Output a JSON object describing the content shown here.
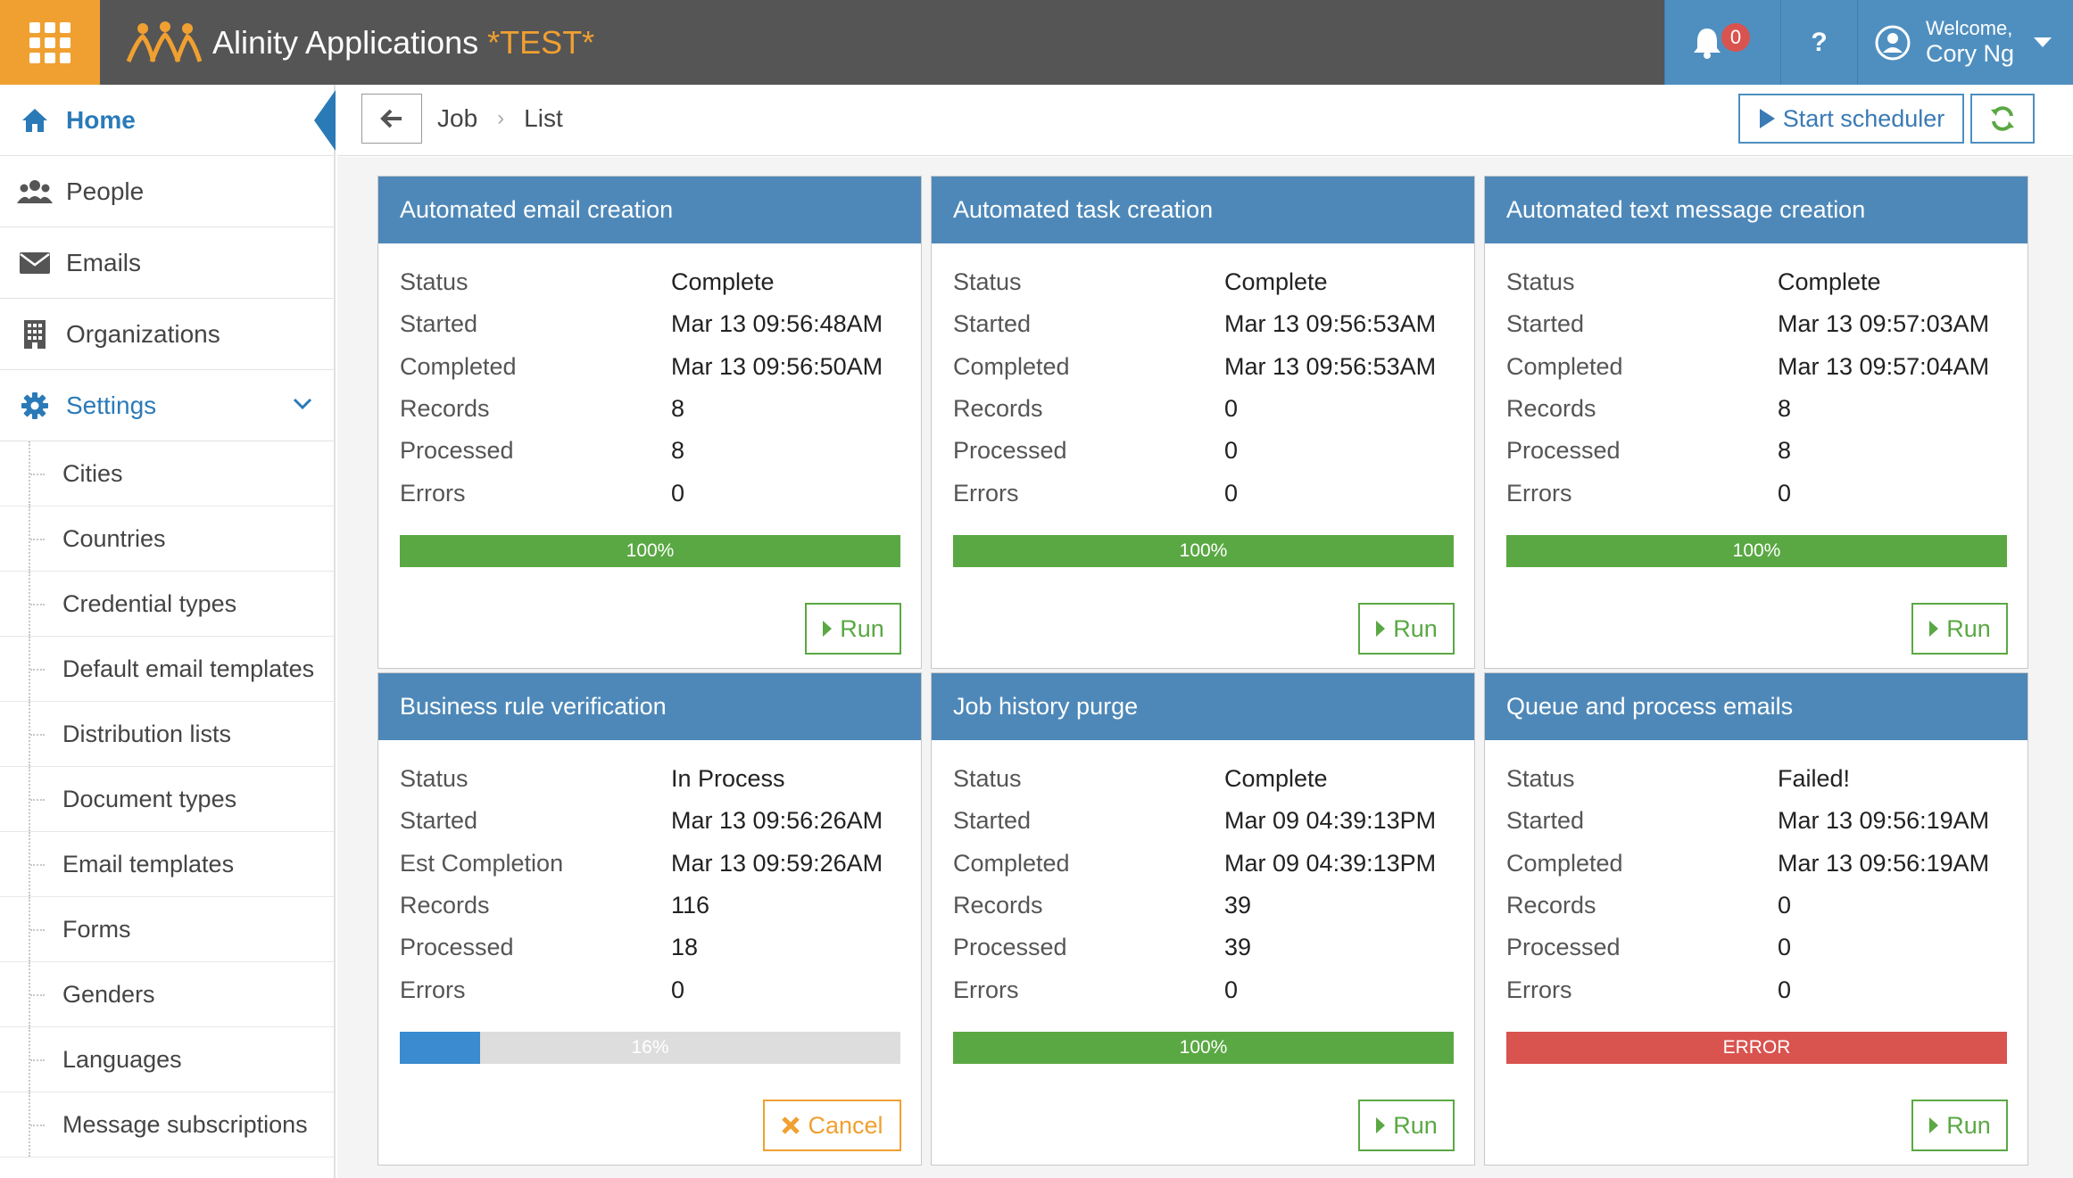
{
  "app": {
    "title": "Alinity Applications",
    "env": "*TEST*"
  },
  "topbar": {
    "notifications_count": "0",
    "help_label": "?",
    "welcome": "Welcome,",
    "user_name": "Cory Ng"
  },
  "sidebar": {
    "items": [
      {
        "label": "Home",
        "icon": "home-icon"
      },
      {
        "label": "People",
        "icon": "people-icon"
      },
      {
        "label": "Emails",
        "icon": "envelope-icon"
      },
      {
        "label": "Organizations",
        "icon": "building-icon"
      },
      {
        "label": "Settings",
        "icon": "gear-icon"
      }
    ],
    "settings_items": [
      "Cities",
      "Countries",
      "Credential types",
      "Default email templates",
      "Distribution lists",
      "Document types",
      "Email templates",
      "Forms",
      "Genders",
      "Languages",
      "Message subscriptions"
    ]
  },
  "breadcrumb": {
    "items": [
      "Job",
      "List"
    ]
  },
  "toolbar": {
    "start_scheduler": "Start scheduler"
  },
  "colors": {
    "header": "#4e88b8",
    "success": "#5aa843",
    "progress": "#3a8bd0",
    "error": "#d9534f",
    "brand": "#f0a031"
  },
  "jobs": [
    {
      "title": "Automated email creation",
      "rows": [
        [
          "Status",
          "Complete"
        ],
        [
          "Started",
          "Mar 13 09:56:48AM"
        ],
        [
          "Completed",
          "Mar 13 09:56:50AM"
        ],
        [
          "Records",
          "8"
        ],
        [
          "Processed",
          "8"
        ],
        [
          "Errors",
          "0"
        ]
      ],
      "progress": 1.0,
      "progress_label": "100%",
      "state": "complete",
      "button": "Run"
    },
    {
      "title": "Automated task creation",
      "rows": [
        [
          "Status",
          "Complete"
        ],
        [
          "Started",
          "Mar 13 09:56:53AM"
        ],
        [
          "Completed",
          "Mar 13 09:56:53AM"
        ],
        [
          "Records",
          "0"
        ],
        [
          "Processed",
          "0"
        ],
        [
          "Errors",
          "0"
        ]
      ],
      "progress": 1.0,
      "progress_label": "100%",
      "state": "complete",
      "button": "Run"
    },
    {
      "title": "Automated text message creation",
      "rows": [
        [
          "Status",
          "Complete"
        ],
        [
          "Started",
          "Mar 13 09:57:03AM"
        ],
        [
          "Completed",
          "Mar 13 09:57:04AM"
        ],
        [
          "Records",
          "8"
        ],
        [
          "Processed",
          "8"
        ],
        [
          "Errors",
          "0"
        ]
      ],
      "progress": 1.0,
      "progress_label": "100%",
      "state": "complete",
      "button": "Run"
    },
    {
      "title": "Business rule verification",
      "rows": [
        [
          "Status",
          "In Process"
        ],
        [
          "Started",
          "Mar 13 09:56:26AM"
        ],
        [
          "Est Completion",
          "Mar 13 09:59:26AM"
        ],
        [
          "Records",
          "116"
        ],
        [
          "Processed",
          "18"
        ],
        [
          "Errors",
          "0"
        ]
      ],
      "progress": 0.16,
      "progress_label": "16%",
      "state": "inprocess",
      "button": "Cancel"
    },
    {
      "title": "Job history purge",
      "rows": [
        [
          "Status",
          "Complete"
        ],
        [
          "Started",
          "Mar 09 04:39:13PM"
        ],
        [
          "Completed",
          "Mar 09 04:39:13PM"
        ],
        [
          "Records",
          "39"
        ],
        [
          "Processed",
          "39"
        ],
        [
          "Errors",
          "0"
        ]
      ],
      "progress": 1.0,
      "progress_label": "100%",
      "state": "complete",
      "button": "Run"
    },
    {
      "title": "Queue and process emails",
      "rows": [
        [
          "Status",
          "Failed!"
        ],
        [
          "Started",
          "Mar 13 09:56:19AM"
        ],
        [
          "Completed",
          "Mar 13 09:56:19AM"
        ],
        [
          "Records",
          "0"
        ],
        [
          "Processed",
          "0"
        ],
        [
          "Errors",
          "0"
        ]
      ],
      "progress": 1.0,
      "progress_label": "ERROR",
      "state": "error",
      "button": "Run"
    }
  ]
}
